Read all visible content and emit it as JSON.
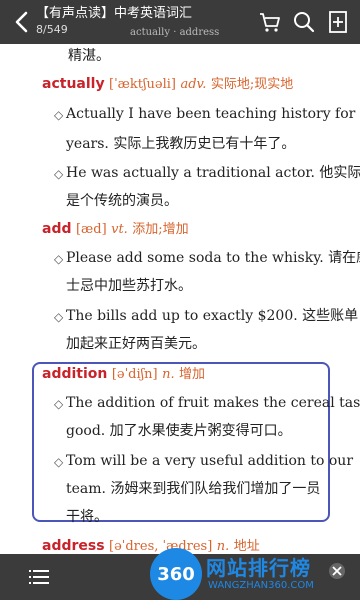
{
  "topbar": {
    "title": "【有声点读】中考英语词汇",
    "page": "8/549",
    "hint": "actually · address"
  },
  "entries": {
    "pre_text": "精湛。",
    "actually": {
      "headword": "actually",
      "phonetic": "[ˈæktʃuəli]",
      "pos": "adv.",
      "def": "实际地;现实地",
      "ex1_a": "Actually I have been teaching history for ten",
      "ex1_b": "years. 实际上我教历史已有十年了。",
      "ex2_a": "He was actually a traditional actor. 他实际上",
      "ex2_b": "是个传统的演员。"
    },
    "add": {
      "headword": "add",
      "phonetic": "[æd]",
      "pos": "vt.",
      "def": "添加;增加",
      "ex1_a": "Please add some soda to the whisky. 请在威",
      "ex1_b": "士忌中加些苏打水。",
      "ex2_a": "The bills add up to exactly $200. 这些账单",
      "ex2_b": "加起来正好两百美元。"
    },
    "addition": {
      "headword": "addition",
      "phonetic": "[əˈdiʃn]",
      "pos": "n.",
      "def": "增加",
      "ex1_a": "The addition of fruit makes the cereal taste",
      "ex1_b": "good. 加了水果使麦片粥变得可口。",
      "ex2_a": "Tom will be a very useful addition to our",
      "ex2_b": "team. 汤姆来到我们队给我们增加了一员",
      "ex2_c": "干将。"
    },
    "address": {
      "headword": "address",
      "phonetic": "[əˈdres, ˈædres]",
      "pos": "n.",
      "def": "地址"
    }
  },
  "bullet": "◇",
  "watermark": {
    "logo": "360",
    "text": "网站排行榜",
    "sub": "WANGZHAN360.COM"
  },
  "colors": {
    "bar": "#3b3b3b",
    "headword": "#c8232a",
    "phonetic": "#d7642e",
    "highlight_box": "#4b56b8"
  },
  "icons": [
    "back-arrow-icon",
    "cart-icon",
    "search-icon",
    "add-bookmark-icon",
    "menu-icon",
    "close-icon"
  ]
}
